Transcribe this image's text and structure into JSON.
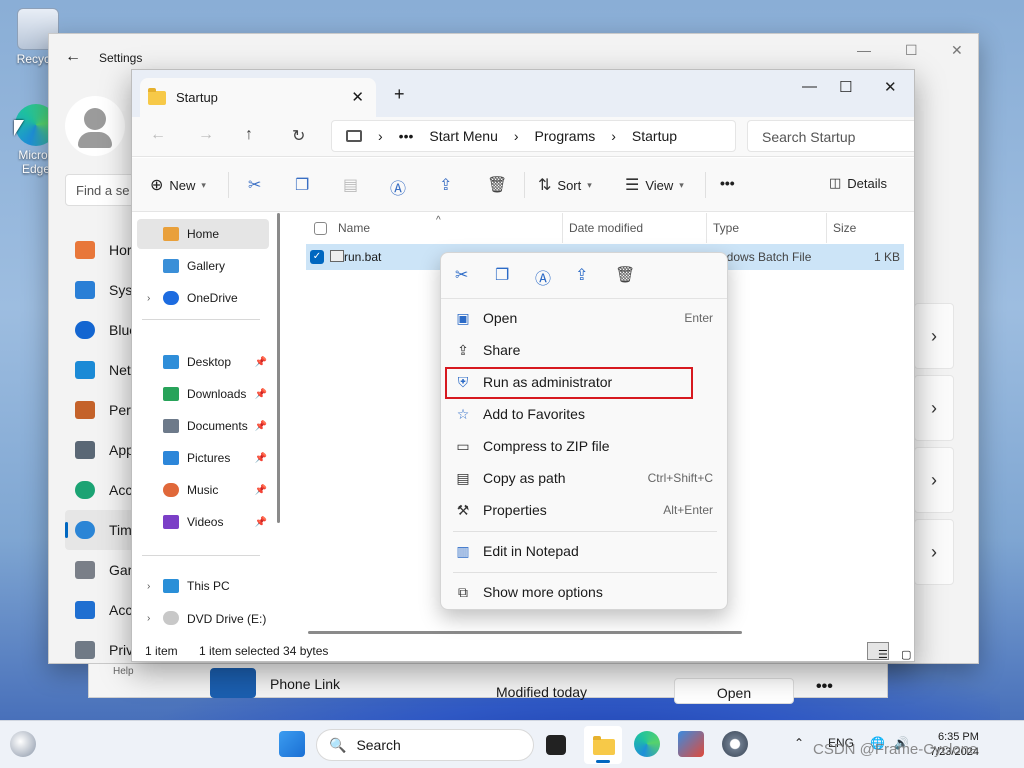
{
  "desktop": {
    "recycle_label": "Recycle",
    "edge_label_1": "Micros",
    "edge_label_2": "Edge"
  },
  "settings": {
    "title": "Settings",
    "find_placeholder": "Find a se",
    "nav": [
      "Hor",
      "Syst",
      "Blue",
      "Net",
      "Pers",
      "App",
      "Acc",
      "Tim",
      "Gar",
      "Acc",
      "Priv"
    ],
    "nav_active_index": 7
  },
  "bg_explorer": {
    "help": "Help",
    "app_name": "Phone Link",
    "modified": "Modified today",
    "open_label": "Open",
    "more": "•••"
  },
  "explorer": {
    "tab_title": "Startup",
    "breadcrumb": [
      "•••",
      "Start Menu",
      "Programs",
      "Startup"
    ],
    "search_placeholder": "Search Startup",
    "commands": {
      "new": "New",
      "sort": "Sort",
      "view": "View",
      "more": "•••",
      "details": "Details"
    },
    "sidebar": {
      "home": "Home",
      "gallery": "Gallery",
      "onedrive": "OneDrive",
      "desktop": "Desktop",
      "downloads": "Downloads",
      "documents": "Documents",
      "pictures": "Pictures",
      "music": "Music",
      "videos": "Videos",
      "thispc": "This PC",
      "dvd": "DVD Drive (E:) 微"
    },
    "columns": {
      "name": "Name",
      "date": "Date modified",
      "type": "Type",
      "size": "Size"
    },
    "file": {
      "name": "run.bat",
      "type": "ndows Batch File",
      "size": "1 KB"
    },
    "status": {
      "count": "1 item",
      "selected": "1 item selected  34 bytes"
    }
  },
  "context_menu": {
    "items": [
      {
        "label": "Open",
        "shortcut": "Enter"
      },
      {
        "label": "Share",
        "shortcut": ""
      },
      {
        "label": "Run as administrator",
        "shortcut": ""
      },
      {
        "label": "Add to Favorites",
        "shortcut": ""
      },
      {
        "label": "Compress to ZIP file",
        "shortcut": ""
      },
      {
        "label": "Copy as path",
        "shortcut": "Ctrl+Shift+C"
      },
      {
        "label": "Properties",
        "shortcut": "Alt+Enter"
      },
      {
        "label": "Edit in Notepad",
        "shortcut": ""
      },
      {
        "label": "Show more options",
        "shortcut": ""
      }
    ],
    "highlight_color": "#d71920"
  },
  "taskbar": {
    "search_placeholder": "Search",
    "lang": "ENG",
    "time": "6:35 PM",
    "date": "7/23/2024",
    "watermark": "CSDN @Frame-Cyclone"
  },
  "colors": {
    "accent": "#0067c0",
    "selection": "#cce4f7"
  }
}
